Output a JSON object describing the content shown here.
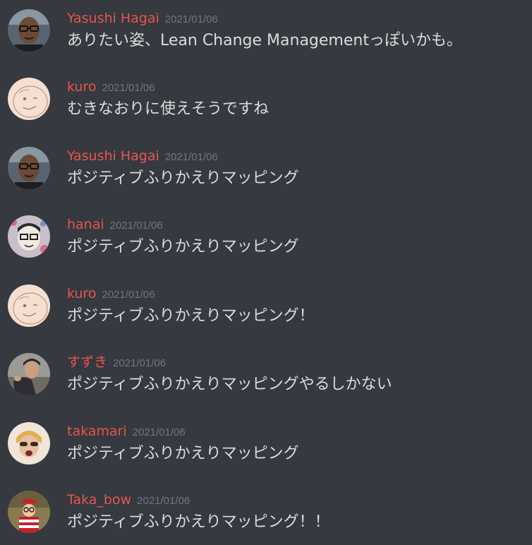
{
  "colors": {
    "background": "#36393f",
    "author": "#e5564e",
    "timestamp": "#72767d",
    "text": "#dcddde"
  },
  "messages": [
    {
      "author": "Yasushi Hagai",
      "timestamp": "2021/01/06",
      "text": "ありたい姿、Lean Change Managementっぽいかも。",
      "avatar": "man-glasses-avatar"
    },
    {
      "author": "kuro",
      "timestamp": "2021/01/06",
      "text": "むきなおりに使えそうですね",
      "avatar": "sketch-face-avatar"
    },
    {
      "author": "Yasushi Hagai",
      "timestamp": "2021/01/06",
      "text": "ポジティブふりかえりマッピング",
      "avatar": "man-glasses-avatar"
    },
    {
      "author": "hanai",
      "timestamp": "2021/01/06",
      "text": "ポジティブふりかえりマッピング",
      "avatar": "cartoon-glasses-avatar"
    },
    {
      "author": "kuro",
      "timestamp": "2021/01/06",
      "text": "ポジティブふりかえりマッピング！",
      "avatar": "sketch-face-avatar"
    },
    {
      "author": "すずき",
      "timestamp": "2021/01/06",
      "text": "ポジティブふりかえりマッピングやるしかない",
      "avatar": "person-photo-avatar"
    },
    {
      "author": "takamari",
      "timestamp": "2021/01/06",
      "text": "ポジティブふりかえりマッピング",
      "avatar": "sunglasses-face-avatar"
    },
    {
      "author": "Taka_bow",
      "timestamp": "2021/01/06",
      "text": "ポジティブふりかえりマッピング！！",
      "avatar": "striped-character-avatar"
    }
  ]
}
